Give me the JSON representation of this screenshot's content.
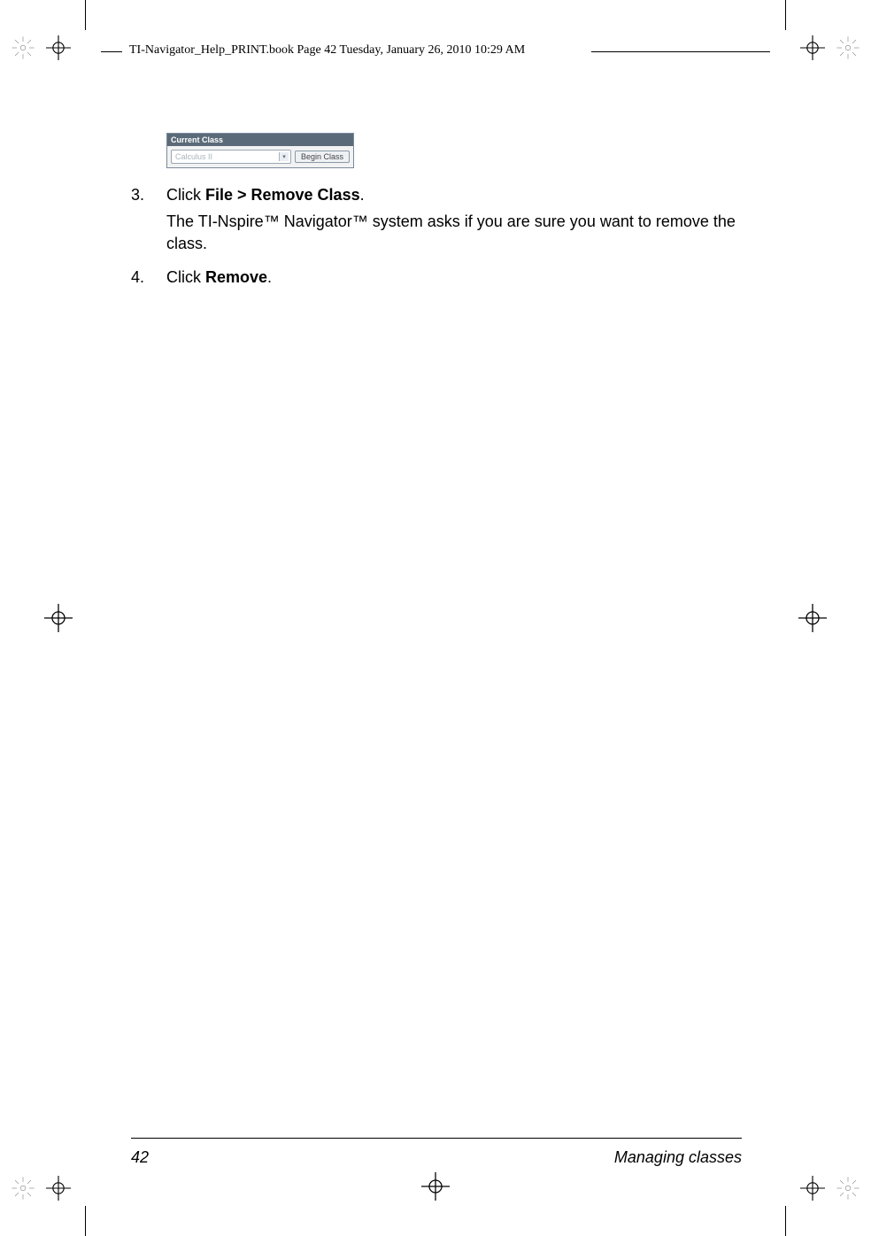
{
  "header": {
    "running_head": "TI-Navigator_Help_PRINT.book  Page 42  Tuesday, January 26, 2010  10:29 AM"
  },
  "mini_ui": {
    "title": "Current Class",
    "selected_class": "Calculus II",
    "button_label": "Begin Class"
  },
  "steps": {
    "s3": {
      "num": "3.",
      "prefix": "Click ",
      "bold": "File > Remove Class",
      "suffix": ".",
      "sub": "The TI-Nspire™ Navigator™ system asks if you are sure you want to remove the class."
    },
    "s4": {
      "num": "4.",
      "prefix": "Click ",
      "bold": "Remove",
      "suffix": "."
    }
  },
  "footer": {
    "page_number": "42",
    "section": "Managing classes"
  }
}
